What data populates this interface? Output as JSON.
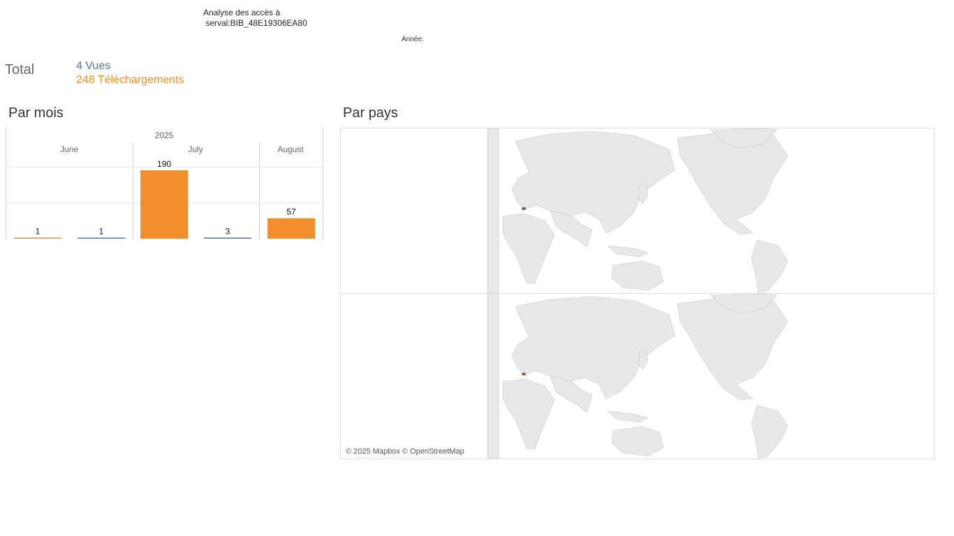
{
  "header": {
    "title": "Analyse des accès à\n serval:BIB_48E19306EA80",
    "year_label": "Année:"
  },
  "totals": {
    "label": "Total",
    "views": "4 Vues",
    "downloads": "248 Téléchargements"
  },
  "sections": {
    "monthly": "Par mois",
    "country": "Par pays"
  },
  "colors": {
    "views": "#4e79a7",
    "downloads": "#f28e2b",
    "land": "#e8e8e8",
    "border": "#c8c8c8"
  },
  "chart_data": {
    "type": "bar",
    "title": "",
    "year": "2025",
    "months": [
      "June",
      "July",
      "August"
    ],
    "bars": [
      {
        "month": "June",
        "series": "Téléchargements",
        "value": 1
      },
      {
        "month": "June",
        "series": "Vues",
        "value": 1
      },
      {
        "month": "July",
        "series": "Téléchargements",
        "value": 190
      },
      {
        "month": "July",
        "series": "Vues",
        "value": 3
      },
      {
        "month": "August",
        "series": "Téléchargements",
        "value": 57
      }
    ],
    "ylim": [
      0,
      190
    ]
  },
  "map": {
    "attribution": "© 2025 Mapbox © OpenStreetMap",
    "highlight_top": "views",
    "highlight_bottom": "downloads"
  }
}
